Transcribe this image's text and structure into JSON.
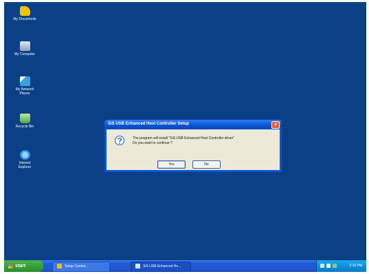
{
  "desktop": {
    "icons": [
      {
        "label": "My Documents",
        "icon": "my-documents-folder-icon",
        "color": "#f2c200"
      },
      {
        "label": "My Computer",
        "icon": "my-computer-icon",
        "color": "#9fb3c8"
      },
      {
        "label": "My Network Places",
        "icon": "network-places-icon",
        "color": "#3aa0d8"
      },
      {
        "label": "Recycle Bin",
        "icon": "recycle-bin-icon",
        "color": "#6cc04a"
      },
      {
        "label": "Internet Explorer",
        "icon": "internet-explorer-icon",
        "color": "#2f8fe0"
      }
    ]
  },
  "dialog": {
    "title": "SiS USB Enhanced Host Controller Setup",
    "message_line1": "The program will install \"SiS USB Enhanced Host Controller driver\"",
    "message_line2": "Do you want to continue ?",
    "yes_label": "Yes",
    "no_label": "No",
    "close_label": "✕"
  },
  "taskbar": {
    "start_label": "start",
    "tasks": [
      {
        "label": "Setup Conten...",
        "icon": "folder-icon"
      },
      {
        "label": "SiS USB Enhanced Ho...",
        "icon": "setup-icon"
      }
    ],
    "clock": "2:16 PM"
  },
  "colors": {
    "desktop_bg": "#0b3f86",
    "titlebar": "#0b57d6",
    "taskbar": "#245edb",
    "start_green": "#36a136",
    "tray": "#0f8fdc"
  }
}
